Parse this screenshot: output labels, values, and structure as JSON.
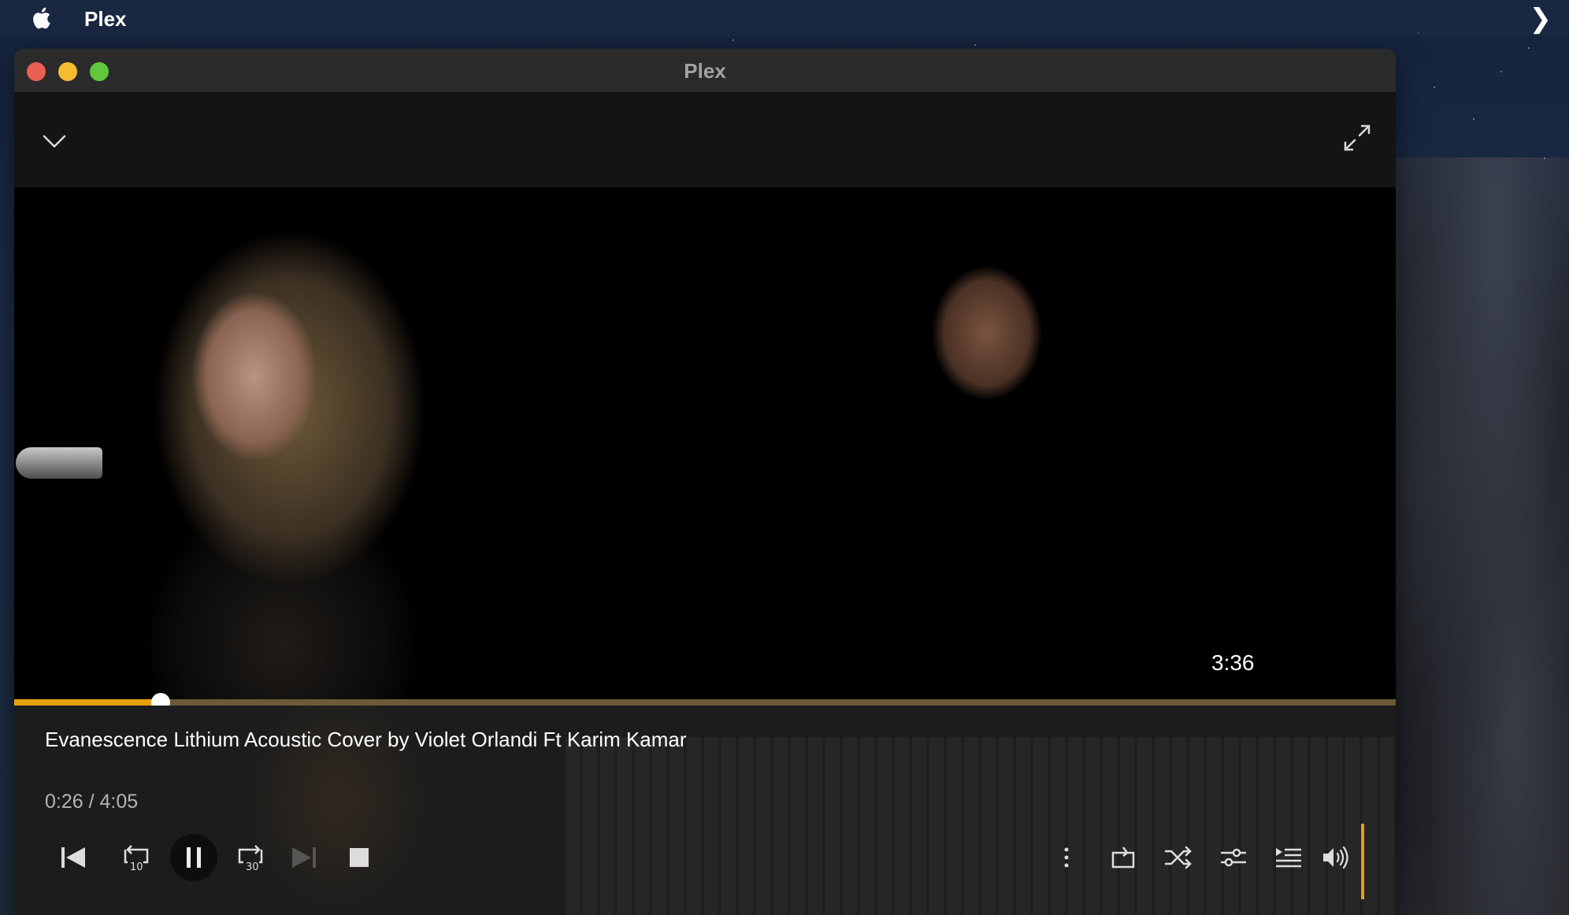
{
  "menubar": {
    "app_name": "Plex"
  },
  "window": {
    "title": "Plex"
  },
  "player": {
    "remaining_time": "3:36",
    "track_title": "Evanescence Lithium Acoustic Cover by Violet Orlandi Ft Karim Kamar",
    "elapsed": "0:26",
    "duration": "4:05",
    "time_readout": "0:26 / 4:05",
    "progress_fraction": 0.106,
    "accent_color": "#e5a00d"
  },
  "controls": {
    "left": [
      "skip-previous-icon",
      "replay-10-icon",
      "pause-icon",
      "forward-30-icon",
      "skip-next-icon",
      "stop-icon"
    ],
    "right": [
      "more-vertical-icon",
      "repeat-icon",
      "shuffle-icon",
      "equalizer-settings-icon",
      "play-queue-icon",
      "volume-icon"
    ],
    "replay_label": "10",
    "forward_label": "30"
  }
}
